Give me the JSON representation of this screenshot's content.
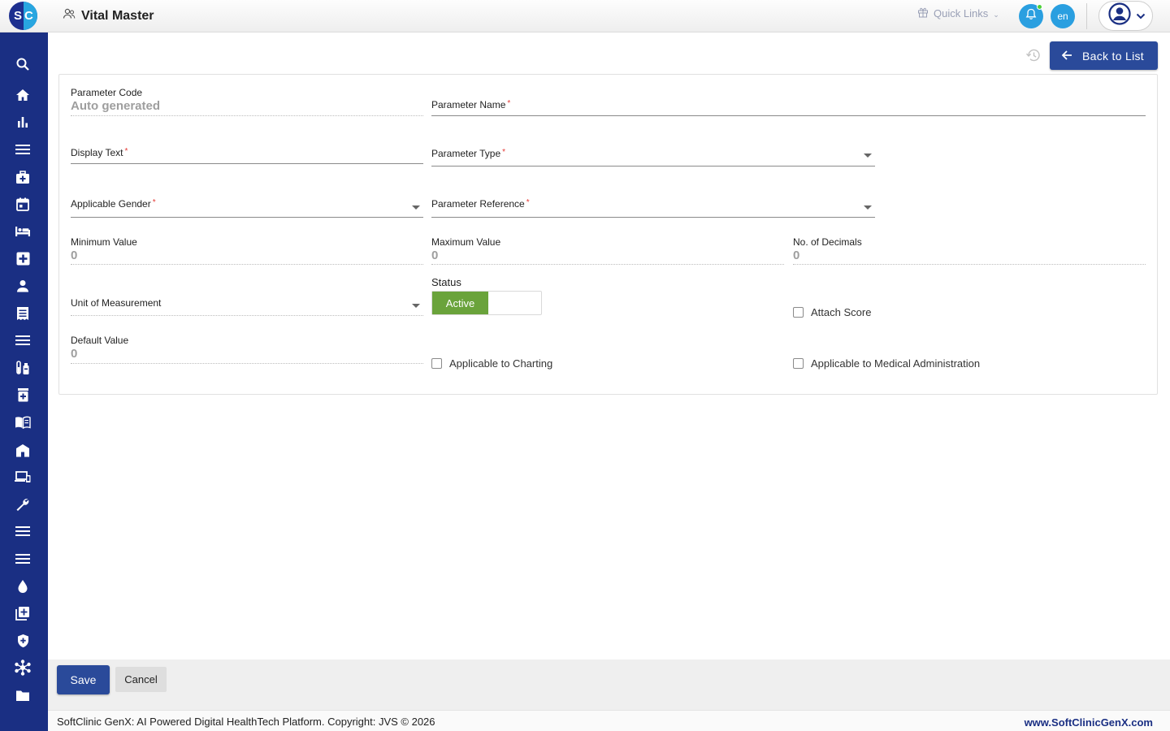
{
  "app": {
    "logo_letters": [
      "S",
      "C"
    ],
    "page_title": "Vital Master"
  },
  "header": {
    "quick_links": "Quick Links",
    "language": "en"
  },
  "sidebar": {
    "icons": [
      "search-icon",
      "home-icon",
      "bar-chart-icon",
      "menu-icon",
      "medical-bag-icon",
      "calendar-icon",
      "bed-icon",
      "medical-cross-icon",
      "person-icon",
      "receipt-icon",
      "menu-icon",
      "lab-icon",
      "pharmacy-icon",
      "book-icon",
      "hospital-icon",
      "devices-icon",
      "wrench-icon",
      "menu-icon",
      "menu-icon",
      "blood-drop-icon",
      "add-library-icon",
      "shield-icon",
      "hub-icon",
      "folder-icon"
    ]
  },
  "toolbar": {
    "back_label": "Back to List"
  },
  "form": {
    "parameter_code": {
      "label": "Parameter Code",
      "value": "Auto generated"
    },
    "parameter_name": {
      "label": "Parameter Name",
      "required": "*"
    },
    "display_text": {
      "label": "Display Text",
      "required": "*"
    },
    "parameter_type": {
      "label": "Parameter Type",
      "required": "*"
    },
    "applicable_gender": {
      "label": "Applicable Gender",
      "required": "*"
    },
    "parameter_reference": {
      "label": "Parameter Reference",
      "required": "*"
    },
    "minimum_value": {
      "label": "Minimum Value",
      "value": "0"
    },
    "maximum_value": {
      "label": "Maximum Value",
      "value": "0"
    },
    "no_of_decimals": {
      "label": "No. of Decimals",
      "value": "0"
    },
    "unit_of_measurement": {
      "label": "Unit of Measurement"
    },
    "status": {
      "label": "Status",
      "active_label": "Active"
    },
    "attach_score": {
      "label": "Attach Score"
    },
    "default_value": {
      "label": "Default Value",
      "value": "0"
    },
    "applicable_to_charting": {
      "label": "Applicable to Charting"
    },
    "applicable_to_medical_administration": {
      "label": "Applicable to Medical Administration"
    }
  },
  "actions": {
    "save_label": "Save",
    "cancel_label": "Cancel"
  },
  "footer": {
    "copyright": "SoftClinic GenX: AI Powered Digital HealthTech Platform. Copyright: JVS © 2026",
    "site": "www.SoftClinicGenX.com"
  },
  "colors": {
    "sidebar": "#1a2f83",
    "primary_button": "#2a4a9a",
    "active_toggle": "#6aa33b",
    "accent_blue": "#2a9fe0",
    "required": "#e53935"
  }
}
